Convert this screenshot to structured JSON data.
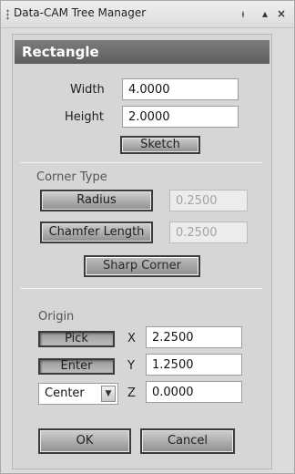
{
  "window": {
    "title": "Data-CAM Tree Manager",
    "pin_glyph": "ᵼ",
    "float_glyph": "▴",
    "close_glyph": "×"
  },
  "panel": {
    "header": "Rectangle",
    "width_label": "Width",
    "width_value": "4.0000",
    "height_label": "Height",
    "height_value": "2.0000",
    "sketch_button": "Sketch",
    "corner_type_label": "Corner Type",
    "radius_button": "Radius",
    "radius_value": "0.2500",
    "chamfer_button": "Chamfer Length",
    "chamfer_value": "0.2500",
    "sharp_corner_button": "Sharp Corner",
    "origin_label": "Origin",
    "pick_button": "Pick",
    "enter_button": "Enter",
    "x_label": "X",
    "x_value": "2.2500",
    "y_label": "Y",
    "y_value": "1.2500",
    "z_label": "Z",
    "z_value": "0.0000",
    "origin_select_value": "Center",
    "ok_button": "OK",
    "cancel_button": "Cancel"
  }
}
